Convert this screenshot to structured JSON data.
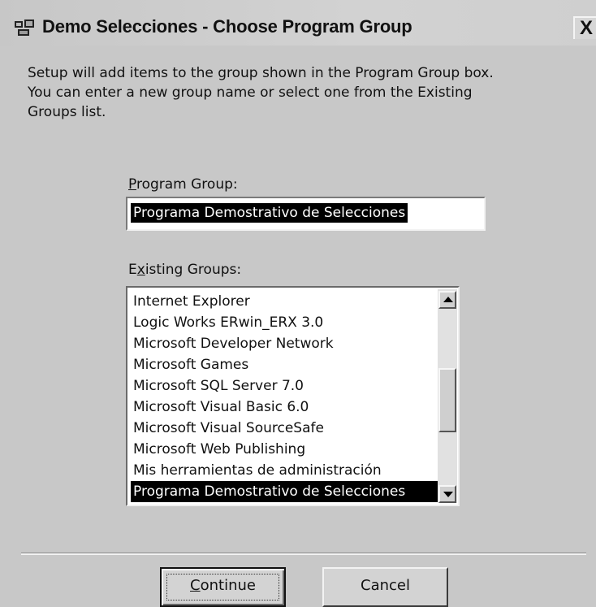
{
  "window": {
    "title": "Demo Selecciones - Choose Program Group",
    "close_label": "X"
  },
  "instructions": {
    "line1": "Setup will add items to the group shown in the Program Group box.",
    "line2": "You can enter a new group name or select one from the Existing",
    "line3": "Groups list."
  },
  "program_group": {
    "label_accel": "P",
    "label_rest": "rogram Group:",
    "value": "Programa Demostrativo de Selecciones"
  },
  "existing_groups": {
    "label_before": "E",
    "label_accel": "x",
    "label_rest": "isting Groups:",
    "items": [
      "Internet Explorer",
      "Logic Works ERwin_ERX 3.0",
      "Microsoft Developer Network",
      "Microsoft Games",
      "Microsoft SQL Server 7.0",
      "Microsoft Visual Basic 6.0",
      "Microsoft Visual SourceSafe",
      "Microsoft Web Publishing",
      "Mis herramientas de administración",
      "Programa Demostrativo de Selecciones"
    ],
    "selected_index": 9
  },
  "buttons": {
    "continue_accel": "C",
    "continue_rest": "ontinue",
    "cancel_label": "Cancel"
  }
}
